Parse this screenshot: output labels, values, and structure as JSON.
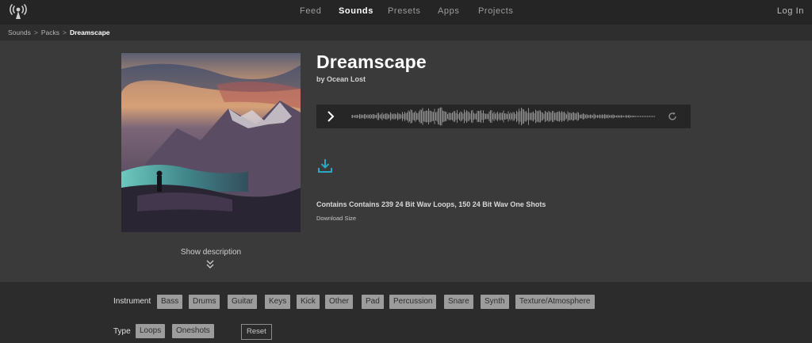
{
  "nav": {
    "links": [
      "Feed",
      "Sounds",
      "Presets",
      "Apps",
      "Projects"
    ],
    "active_index": 1,
    "login_label": "Log In",
    "logo_icon": "broadcast-icon"
  },
  "breadcrumb": {
    "items": [
      "Sounds",
      "Packs"
    ],
    "current": "Dreamscape",
    "separator": ">"
  },
  "pack": {
    "title": "Dreamscape",
    "byline": "by Ocean Lost",
    "contains": "Contains Contains 239 24 Bit Wav Loops, 150 24 Bit Wav One Shots",
    "download_size_label": "Download Size",
    "show_description_label": "Show description"
  },
  "player": {
    "play_icon": "play-icon",
    "reload_icon": "reload-icon",
    "waveform_color": "#8e8e8e"
  },
  "download": {
    "icon": "download-icon",
    "color": "#2aa7c4"
  },
  "filters": {
    "instrument_label": "Instrument",
    "instruments": [
      "Bass",
      "Drums",
      "Guitar",
      "Keys",
      "Kick",
      "Other",
      "Pad",
      "Percussion",
      "Snare",
      "Synth",
      "Texture/Atmosphere"
    ],
    "type_label": "Type",
    "types": [
      "Loops",
      "Oneshots"
    ],
    "reset_label": "Reset"
  }
}
